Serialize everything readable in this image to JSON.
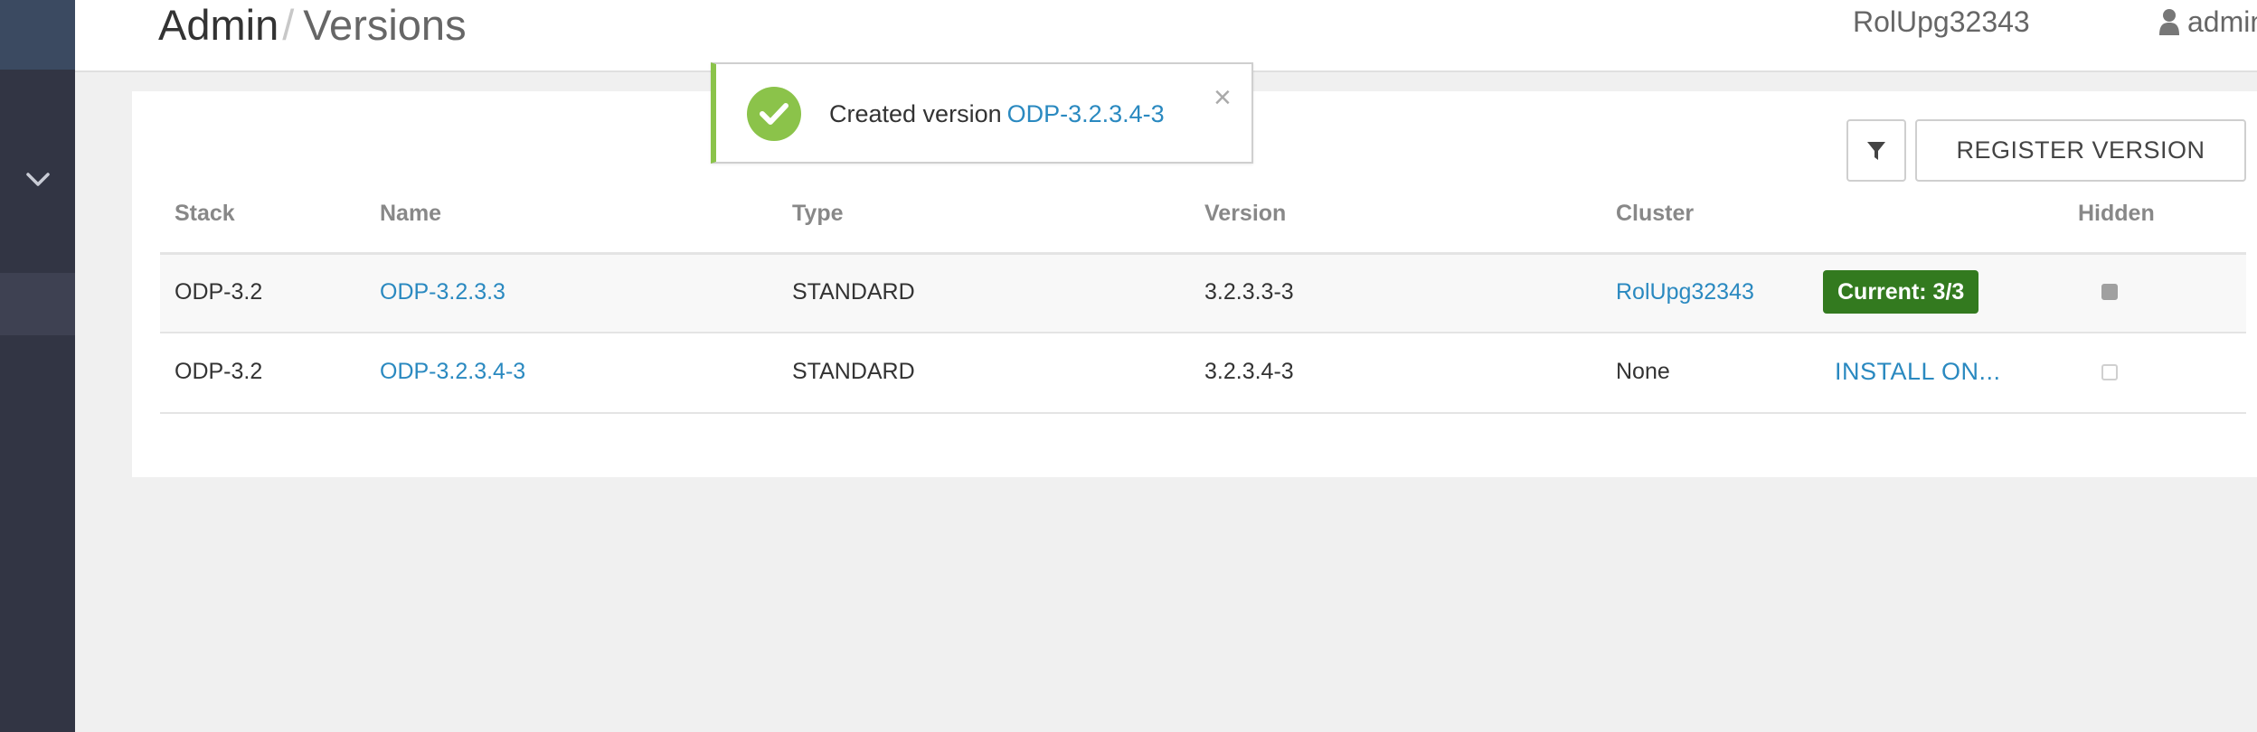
{
  "sidebar": {
    "toggle_icon": "chevron-down-icon",
    "background": "#323544",
    "top_block_color": "#3b4a61",
    "active_item_color": "#3e4152"
  },
  "header": {
    "breadcrumb_root": "Admin",
    "breadcrumb_separator": "/",
    "breadcrumb_current": "Versions",
    "cluster_name": "RolUpg32343",
    "user_name": "admin",
    "user_icon": "user-icon",
    "caret_icon": "caret-down-icon"
  },
  "notification": {
    "icon": "check-circle-icon",
    "message": "Created version",
    "link": "ODP-3.2.3.4-3",
    "close": "×",
    "accent": "#8bc34a"
  },
  "toolbar": {
    "filter_icon": "filter-icon",
    "register_label": "REGISTER VERSION"
  },
  "table": {
    "columns": {
      "stack": "Stack",
      "name": "Name",
      "type": "Type",
      "version": "Version",
      "cluster": "Cluster",
      "hidden": "Hidden"
    },
    "rows": [
      {
        "stack": "ODP-3.2",
        "name": "ODP-3.2.3.3",
        "type": "STANDARD",
        "version": "3.2.3.3-3",
        "cluster": "RolUpg32343",
        "status": "Current: 3/3",
        "hidden": true
      },
      {
        "stack": "ODP-3.2",
        "name": "ODP-3.2.3.4-3",
        "type": "STANDARD",
        "version": "3.2.3.4-3",
        "cluster": "None",
        "action": "INSTALL ON...",
        "hidden": false
      }
    ]
  },
  "colors": {
    "link": "#2a89c0",
    "current_badge": "#337a1f",
    "page_background": "#f0f0f0"
  }
}
